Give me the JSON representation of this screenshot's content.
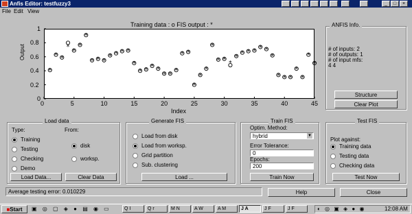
{
  "window": {
    "title": "Anfis Editor: testfuzzy3"
  },
  "menu": [
    "File",
    "Edit",
    "View"
  ],
  "plot": {
    "title": "Training data : o   FIS output : *",
    "xlabel": "Index",
    "ylabel": "Output",
    "yticks": [
      "1",
      "0.8",
      "0.6",
      "0.4",
      "0.2",
      "0"
    ],
    "xticks": [
      "0",
      "5",
      "10",
      "15",
      "20",
      "25",
      "30",
      "35",
      "40",
      "45"
    ]
  },
  "chart_data": {
    "type": "scatter",
    "title": "Training data : o   FIS output : *",
    "xlabel": "Index",
    "ylabel": "Output",
    "xlim": [
      0,
      45
    ],
    "ylim": [
      0,
      1
    ],
    "grid": false,
    "series": [
      {
        "name": "Training data",
        "marker": "o",
        "x": [
          1,
          2,
          3,
          4,
          5,
          6,
          7,
          8,
          9,
          10,
          11,
          12,
          13,
          14,
          15,
          16,
          17,
          18,
          19,
          20,
          21,
          22,
          23,
          24,
          25,
          26,
          27,
          28,
          29,
          30,
          31,
          32,
          33,
          34,
          35,
          36,
          37,
          38,
          39,
          40,
          41,
          42,
          43,
          44,
          45
        ],
        "y": [
          0.41,
          0.63,
          0.59,
          0.8,
          0.69,
          0.77,
          0.91,
          0.55,
          0.57,
          0.55,
          0.62,
          0.65,
          0.68,
          0.69,
          0.51,
          0.4,
          0.42,
          0.47,
          0.43,
          0.36,
          0.36,
          0.41,
          0.65,
          0.67,
          0.2,
          0.34,
          0.43,
          0.77,
          0.56,
          0.57,
          0.48,
          0.61,
          0.66,
          0.68,
          0.69,
          0.74,
          0.71,
          0.62,
          0.34,
          0.31,
          0.31,
          0.43,
          0.31,
          0.63,
          0.51
        ]
      },
      {
        "name": "FIS output",
        "marker": "*",
        "x": [
          1,
          2,
          3,
          4,
          5,
          6,
          7,
          8,
          9,
          10,
          11,
          12,
          13,
          14,
          15,
          16,
          17,
          18,
          19,
          20,
          21,
          22,
          23,
          24,
          25,
          26,
          27,
          28,
          29,
          30,
          31,
          32,
          33,
          34,
          35,
          36,
          37,
          38,
          39,
          40,
          41,
          42,
          43,
          44,
          45
        ],
        "y": [
          0.41,
          0.63,
          0.59,
          0.75,
          0.69,
          0.77,
          0.91,
          0.55,
          0.57,
          0.55,
          0.62,
          0.65,
          0.68,
          0.69,
          0.51,
          0.4,
          0.42,
          0.47,
          0.43,
          0.36,
          0.36,
          0.41,
          0.65,
          0.67,
          0.2,
          0.34,
          0.43,
          0.77,
          0.56,
          0.57,
          0.52,
          0.61,
          0.66,
          0.68,
          0.69,
          0.74,
          0.71,
          0.62,
          0.34,
          0.31,
          0.31,
          0.43,
          0.31,
          0.63,
          0.51
        ]
      }
    ]
  },
  "anfis_info": {
    "title": "ANFIS Info.",
    "lines": [
      "# of inputs: 2",
      "# of outputs: 1",
      "# of input mfs:",
      "4  4"
    ],
    "structure_label": "Structure",
    "clear_plot_label": "Clear Plot"
  },
  "load_data": {
    "title": "Load data",
    "type_label": "Type:",
    "from_label": "From:",
    "types": [
      "Training",
      "Testing",
      "Checking",
      "Demo"
    ],
    "selected_type": "Training",
    "sources": [
      "disk",
      "worksp."
    ],
    "selected_source": "disk",
    "load_button": "Load Data...",
    "clear_button": "Clear Data"
  },
  "generate_fis": {
    "title": "Generate FIS",
    "options": [
      "Load from disk",
      "Load from worksp.",
      "Grid partition",
      "Sub. clustering"
    ],
    "selected": "Load from worksp.",
    "load_button": "Load ..."
  },
  "train_fis": {
    "title": "Train FIS",
    "method_label": "Optim. Method:",
    "method_value": "hybrid",
    "tolerance_label": "Error Tolerance:",
    "tolerance_value": "0",
    "epochs_label": "Epochs:",
    "epochs_value": "200",
    "train_button": "Train Now"
  },
  "test_fis": {
    "title": "Test FIS",
    "plot_against_label": "Plot against:",
    "options": [
      "Training data",
      "Testing data",
      "Checking data"
    ],
    "selected": "Training data",
    "test_button": "Test Now"
  },
  "status": {
    "text": "Average testing error: 0.010229",
    "help_button": "Help",
    "close_button": "Close"
  },
  "taskbar": {
    "start_label": "Start",
    "time": "12:08 AM",
    "tasks": [
      "Q I",
      "Q r",
      "M N",
      "A W",
      "A M",
      "J A",
      "J F",
      "J F"
    ]
  }
}
